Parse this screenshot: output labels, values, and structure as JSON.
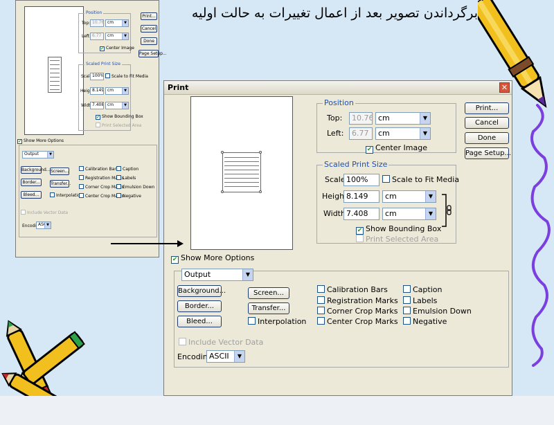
{
  "page": {
    "heading": "برگرداندن تصویر بعد از اعمال تغییرات به حالت اولیه"
  },
  "dialog": {
    "title": "Print",
    "position": {
      "title": "Position",
      "top_label": "Top:",
      "top_value": "10.76",
      "top_unit": "cm",
      "left_label": "Left:",
      "left_value": "6.77",
      "left_unit": "cm",
      "center_image": "Center Image"
    },
    "scaled": {
      "title": "Scaled Print Size",
      "scale_label": "Scale:",
      "scale_value": "100%",
      "scale_to_fit": "Scale to Fit Media",
      "height_label": "Height:",
      "height_value": "8.149",
      "height_unit": "cm",
      "width_label": "Width:",
      "width_value": "7.408",
      "width_unit": "cm",
      "show_bounding_box": "Show Bounding Box",
      "print_selected_area": "Print Selected Area"
    },
    "buttons": {
      "print": "Print...",
      "cancel": "Cancel",
      "done": "Done",
      "page_setup": "Page Setup..."
    },
    "show_more_options": "Show More Options",
    "output_select": "Output",
    "output_buttons": {
      "background": "Background...",
      "border": "Border...",
      "bleed": "Bleed...",
      "screen": "Screen...",
      "transfer": "Transfer..."
    },
    "options": {
      "interpolation": "Interpolation",
      "calibration_bars": "Calibration Bars",
      "registration_marks": "Registration Marks",
      "corner_crop_marks": "Corner Crop Marks",
      "center_crop_marks": "Center Crop Marks",
      "caption": "Caption",
      "labels": "Labels",
      "emulsion_down": "Emulsion Down",
      "negative": "Negative"
    },
    "include_vector_data": "Include Vector Data",
    "encoding_label": "Encoding:",
    "encoding_value": "ASCII"
  },
  "small_dialog": {
    "position_title": "Position",
    "top_label": "Top:",
    "top_value": "10.76",
    "top_unit": "cm",
    "left_label": "Left:",
    "left_value": "6.77",
    "left_unit": "cm",
    "center_image": "Center Image",
    "scaled_title": "Scaled Print Size",
    "scale_label": "Scale:",
    "scale_value": "100%",
    "scale_to_fit": "Scale to Fit Media",
    "height_label": "Height:",
    "height_value": "8.149",
    "height_unit": "cm",
    "width_label": "Width:",
    "width_value": "7.408",
    "width_unit": "cm",
    "show_bounding_box": "Show Bounding Box",
    "print_selected_area": "Print Selected Area",
    "print": "Print...",
    "cancel": "Cancel",
    "done": "Done",
    "page_setup": "Page Setup...",
    "show_more_options": "Show More Options",
    "output_select": "Output",
    "background": "Background...",
    "border": "Border...",
    "bleed": "Bleed...",
    "screen": "Screen...",
    "transfer": "Transfer...",
    "interpolation": "Interpolation",
    "calibration_bars": "Calibration Bars",
    "registration_marks": "Registration Marks",
    "corner_crop_marks": "Corner Crop Marks",
    "center_crop_marks": "Center Crop Marks",
    "caption": "Caption",
    "labels": "Labels",
    "emulsion_down": "Emulsion Down",
    "negative": "Negative",
    "include_vector_data": "Include Vector Data",
    "encoding_label": "Encoding:",
    "encoding_value": "ASCII"
  },
  "colors": {
    "background": "#d6e8f5",
    "dialog": "#ece9d8",
    "group_title": "#1f4fb0",
    "squiggle": "#7b3fe0"
  },
  "icons": [
    "pencil-icon",
    "crayons-icon",
    "chain-link-icon",
    "dropdown-arrow-icon",
    "close-icon"
  ]
}
